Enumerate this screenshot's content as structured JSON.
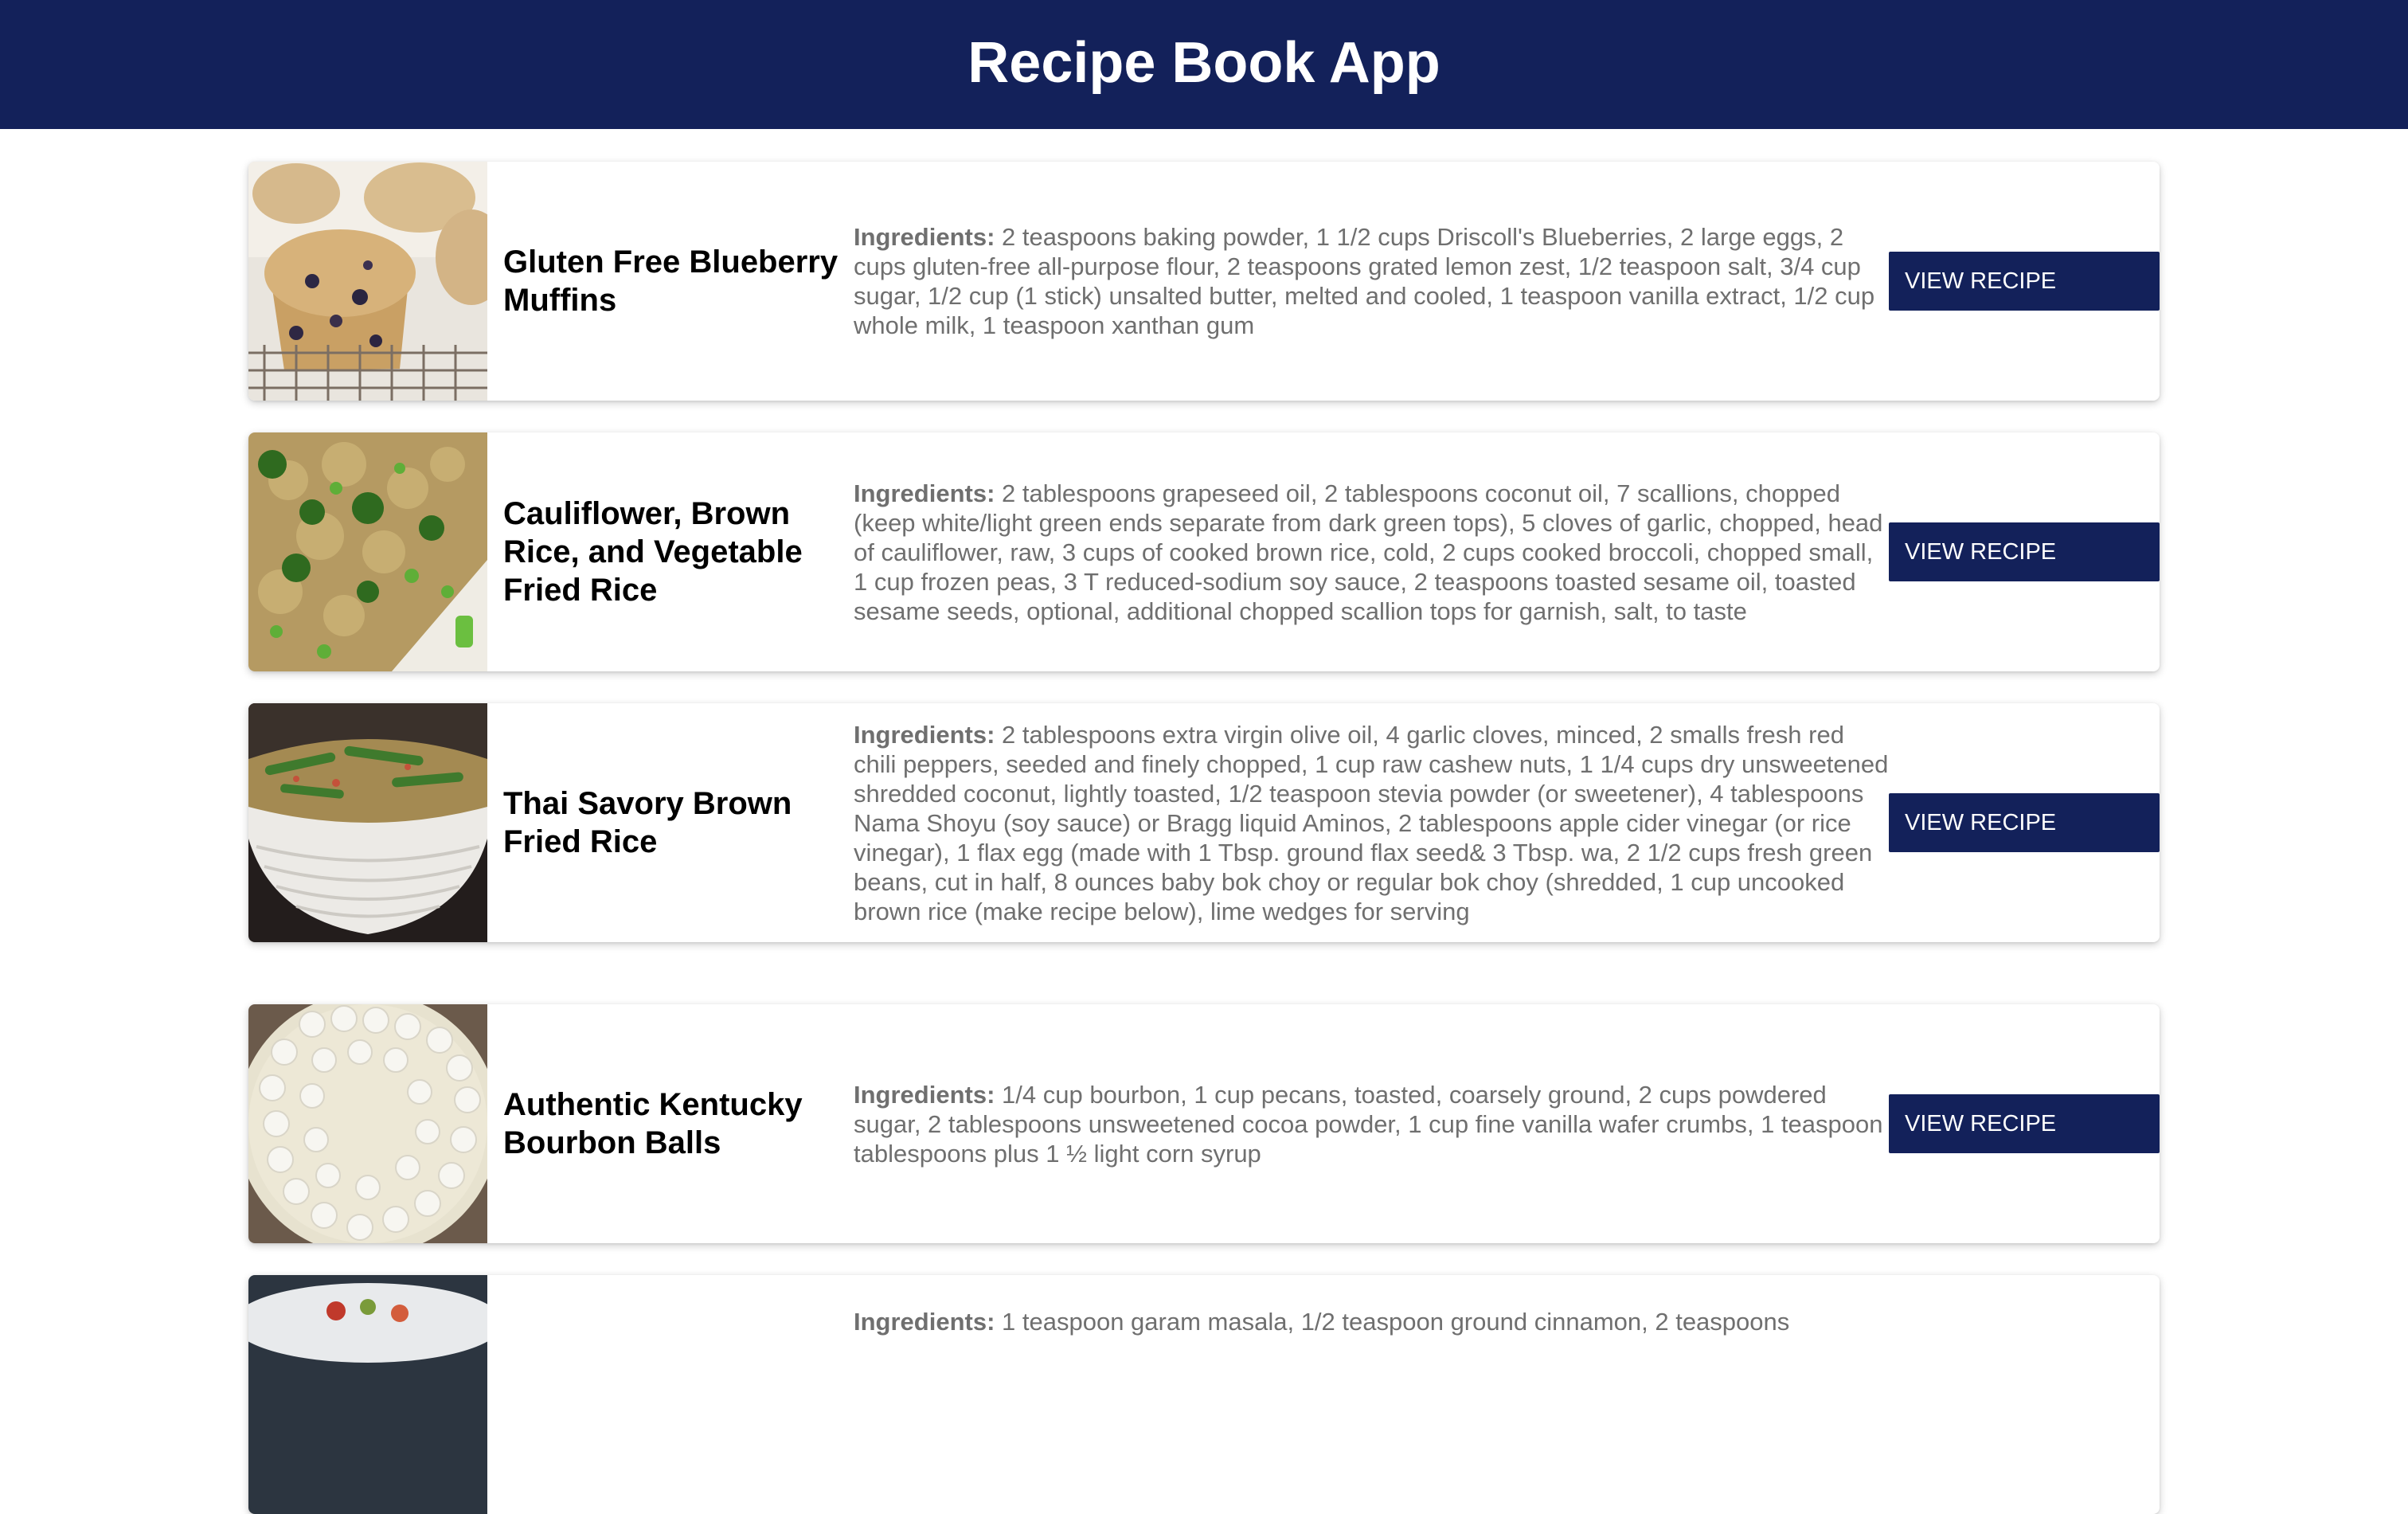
{
  "header": {
    "title": "Recipe Book App"
  },
  "ingredients_label": "Ingredients:",
  "recipes": [
    {
      "title": "Gluten Free Blueberry Muffins",
      "ingredients": "2 teaspoons baking powder, 1 1/2 cups Driscoll's Blueberries, 2 large eggs, 2 cups gluten-free all-purpose flour, 2 teaspoons grated lemon zest, 1/2 teaspoon salt, 3/4 cup sugar, 1/2 cup (1 stick) unsalted butter, melted and cooled, 1 teaspoon vanilla extract, 1/2 cup whole milk, 1 teaspoon xanthan gum",
      "button_label": "VIEW RECIPE",
      "image_icon": "blueberry-muffin-photo"
    },
    {
      "title": "Cauliflower, Brown Rice, and Vegetable Fried Rice",
      "ingredients": "2 tablespoons grapeseed oil, 2 tablespoons coconut oil, 7 scallions, chopped (keep white/light green ends separate from dark green tops), 5 cloves of garlic, chopped, head of cauliflower, raw, 3 cups of cooked brown rice, cold, 2 cups cooked broccoli, chopped small, 1 cup frozen peas, 3 T reduced-sodium soy sauce, 2 teaspoons toasted sesame oil, toasted sesame seeds, optional, additional chopped scallion tops for garnish, salt, to taste",
      "button_label": "VIEW RECIPE",
      "image_icon": "fried-rice-photo"
    },
    {
      "title": "Thai Savory Brown Fried Rice",
      "ingredients": "2 tablespoons extra virgin olive oil, 4 garlic cloves, minced, 2 smalls fresh red chili peppers, seeded and finely chopped, 1 cup raw cashew nuts, 1 1/4 cups dry unsweetened shredded coconut, lightly toasted, 1/2 teaspoon stevia powder (or sweetener), 4 tablespoons Nama Shoyu (soy sauce) or Bragg liquid Aminos, 2 tablespoons apple cider vinegar (or rice vinegar), 1 flax egg (made with 1 Tbsp. ground flax seed& 3 Tbsp. wa, 2 1/2 cups fresh green beans, cut in half, 8 ounces baby bok choy or regular bok choy (shredded, 1 cup uncooked brown rice (make recipe below), lime wedges for serving",
      "button_label": "VIEW RECIPE",
      "image_icon": "rice-bowl-photo"
    },
    {
      "title": "Authentic Kentucky Bourbon Balls",
      "ingredients": "1/4 cup bourbon, 1 cup pecans, toasted, coarsely ground, 2 cups powdered sugar, 2 tablespoons unsweetened cocoa powder, 1 cup fine vanilla wafer crumbs, 1 teaspoon tablespoons plus 1 ½ light corn syrup",
      "button_label": "VIEW RECIPE",
      "image_icon": "bourbon-balls-photo"
    },
    {
      "title": "",
      "ingredients": "1 teaspoon garam masala, 1/2 teaspoon ground cinnamon, 2 teaspoons",
      "button_label": "",
      "image_icon": "salad-plate-photo"
    }
  ],
  "colors": {
    "header_bg": "#13215a",
    "button_bg": "#13215a",
    "title_text": "#ffffff",
    "ingredients_text": "#6f6f6f"
  }
}
